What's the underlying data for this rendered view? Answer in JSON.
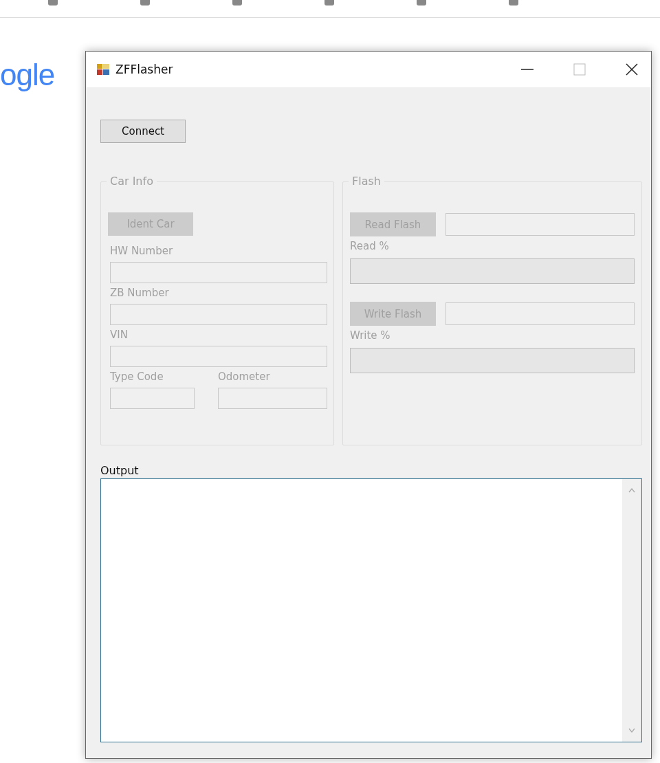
{
  "background": {
    "logo_text": "ogle"
  },
  "window": {
    "title": "ZFFlasher"
  },
  "connect_button": {
    "label": "Connect",
    "disabled": false
  },
  "car_info": {
    "title": "Car Info",
    "ident_button": {
      "label": "Ident Car",
      "disabled": true
    },
    "fields": [
      {
        "label": "HW Number"
      },
      {
        "label": "ZB Number"
      },
      {
        "label": "VIN"
      }
    ],
    "small_fields": [
      {
        "label": "Type Code"
      },
      {
        "label": "Odometer"
      }
    ]
  },
  "flash": {
    "title": "Flash",
    "rows": [
      {
        "button": "Read Flash",
        "disabled": true,
        "progress_label": "Read %",
        "level": 0
      },
      {
        "button": "Write Flash",
        "disabled": true,
        "progress_label": "Write %",
        "level": 0
      }
    ]
  },
  "output": {
    "label": "Output"
  }
}
